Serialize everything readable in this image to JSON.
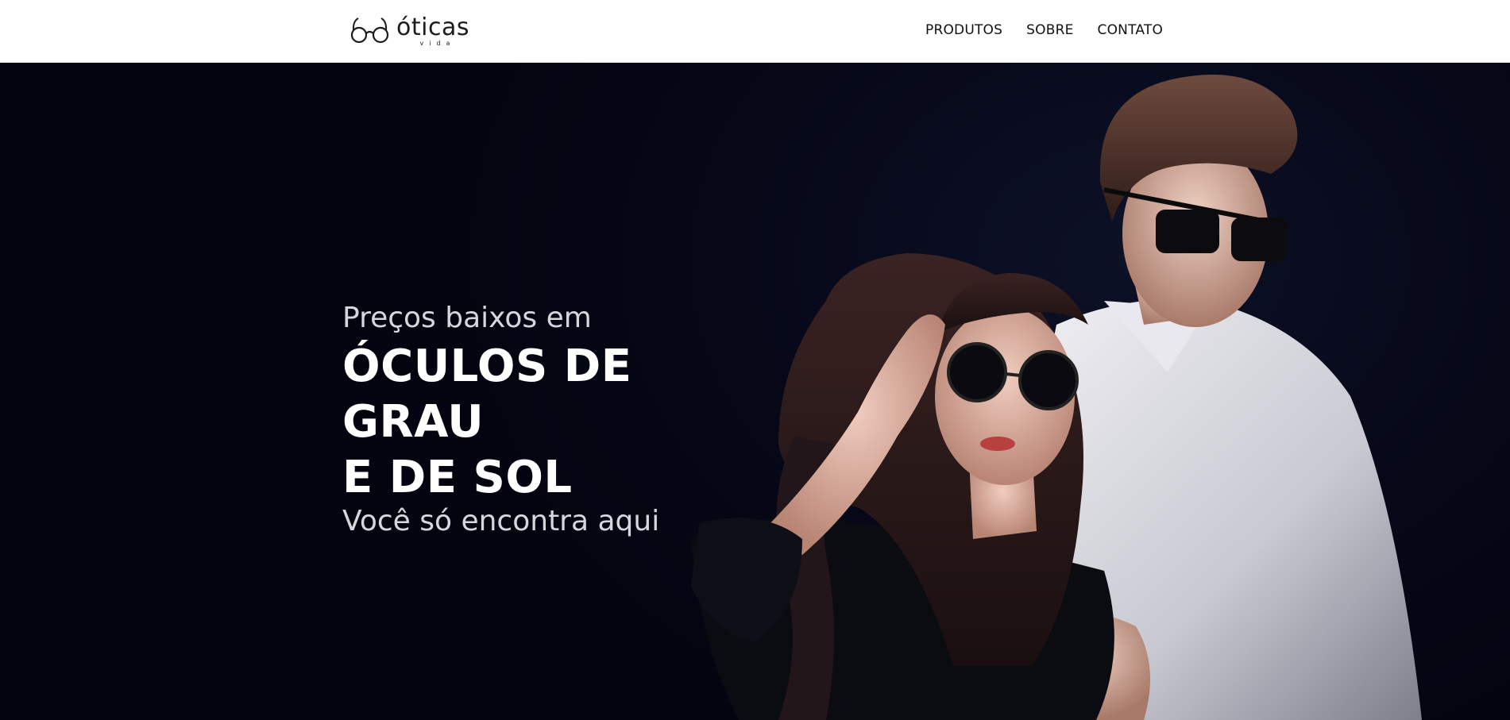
{
  "header": {
    "logo": {
      "name": "óticas",
      "sub": "vida",
      "icon": "glasses-icon"
    },
    "nav": [
      {
        "label": "PRODUTOS"
      },
      {
        "label": "SOBRE"
      },
      {
        "label": "CONTATO"
      }
    ]
  },
  "hero": {
    "pre": "Preços baixos em",
    "title_line1": "ÓCULOS DE GRAU",
    "title_line2": "E DE SOL",
    "sub": "Você só encontra aqui",
    "image": "couple-sunglasses-photo"
  },
  "colors": {
    "header_bg": "#ffffff",
    "hero_bg": "#060818",
    "hero_title": "#ffffff",
    "hero_text": "#d6d6dc",
    "nav_text": "#111111"
  }
}
